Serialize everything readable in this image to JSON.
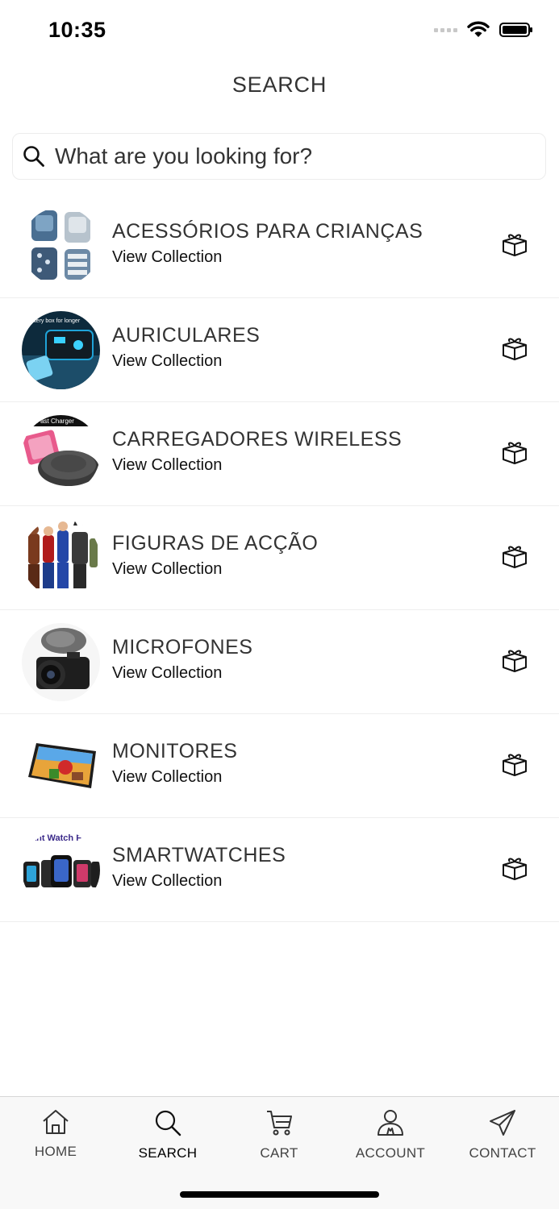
{
  "status": {
    "time": "10:35"
  },
  "header": {
    "title": "SEARCH"
  },
  "search": {
    "placeholder": "What are you looking for?"
  },
  "collections": [
    {
      "title": "ACESSÓRIOS PARA CRIANÇAS",
      "subtitle": "View Collection",
      "thumb": "kids-accessories"
    },
    {
      "title": "AURICULARES",
      "subtitle": "View Collection",
      "thumb": "earphones"
    },
    {
      "title": "CARREGADORES WIRELESS",
      "subtitle": "View Collection",
      "thumb": "wireless-charger"
    },
    {
      "title": "FIGURAS DE ACÇÃO",
      "subtitle": "View Collection",
      "thumb": "action-figures"
    },
    {
      "title": "MICROFONES",
      "subtitle": "View Collection",
      "thumb": "microphone"
    },
    {
      "title": "MONITORES",
      "subtitle": "View Collection",
      "thumb": "monitor"
    },
    {
      "title": "SMARTWATCHES",
      "subtitle": "View Collection",
      "thumb": "smartwatches"
    }
  ],
  "thumb_text": {
    "earphones": "battery box for longer",
    "charger": "s Fast Charger",
    "watches": "ant Watch F"
  },
  "tabs": [
    {
      "label": "HOME",
      "icon": "home-icon"
    },
    {
      "label": "SEARCH",
      "icon": "search-icon",
      "active": true
    },
    {
      "label": "CART",
      "icon": "cart-icon"
    },
    {
      "label": "ACCOUNT",
      "icon": "account-icon"
    },
    {
      "label": "CONTACT",
      "icon": "send-icon"
    }
  ],
  "colors": {
    "text": "#333333",
    "tab_bar_bg": "#f8f8f8",
    "active_tab": "#000000"
  }
}
